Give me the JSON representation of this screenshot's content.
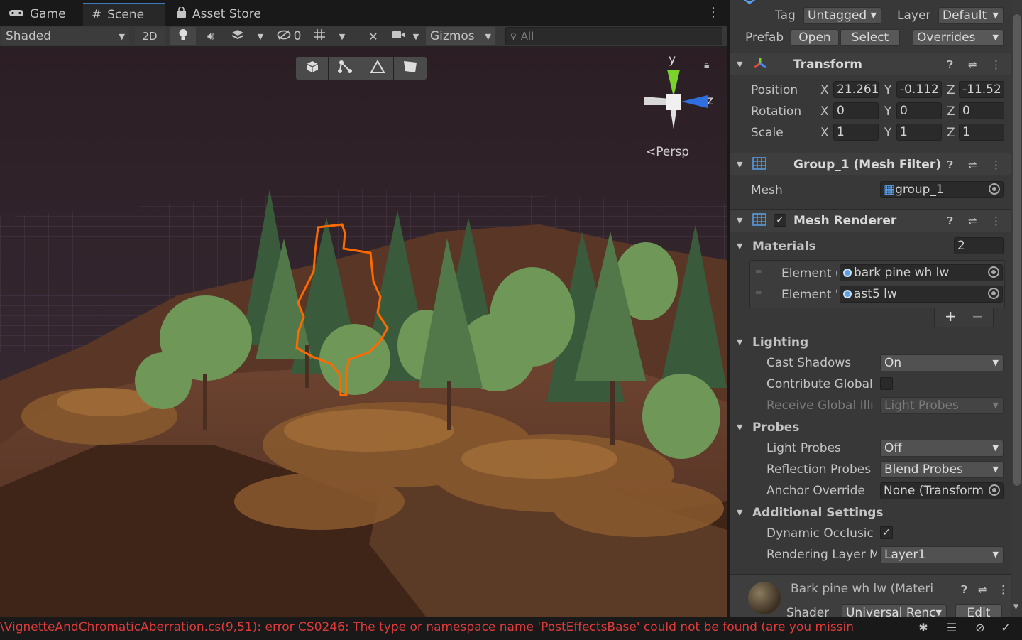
{
  "tabs": [
    {
      "label": "Game",
      "icon": "gamepad-icon"
    },
    {
      "label": "Scene",
      "icon": "grid-icon"
    },
    {
      "label": "Asset Store",
      "icon": "shopping-bag-icon"
    }
  ],
  "toolbar": {
    "shading_mode": "Shaded",
    "mode_2d": "2D",
    "hidden_count": "0",
    "gizmos": "Gizmos",
    "search_placeholder": "All"
  },
  "viewport": {
    "projection_label": "Persp",
    "axis_y": "y",
    "axis_z": "z",
    "selection_color": "#ff6a00"
  },
  "inspector": {
    "tag_label": "Tag",
    "tag_value": "Untagged",
    "layer_label": "Layer",
    "layer_value": "Default",
    "prefab_label": "Prefab",
    "prefab_open": "Open",
    "prefab_select": "Select",
    "prefab_overrides": "Overrides",
    "transform": {
      "title": "Transform",
      "position_label": "Position",
      "rotation_label": "Rotation",
      "scale_label": "Scale",
      "position": {
        "x": "21.261",
        "y": "-0.112",
        "z": "-11.52"
      },
      "rotation": {
        "x": "0",
        "y": "0",
        "z": "0"
      },
      "scale": {
        "x": "1",
        "y": "1",
        "z": "1"
      },
      "x": "X",
      "y": "Y",
      "z": "Z"
    },
    "mesh_filter": {
      "title": "Group_1 (Mesh Filter)",
      "mesh_label": "Mesh",
      "mesh_value": "group_1"
    },
    "mesh_renderer": {
      "title": "Mesh Renderer",
      "materials_label": "Materials",
      "materials_count": "2",
      "elements": [
        {
          "label": "Element (",
          "value": "bark pine wh lw"
        },
        {
          "label": "Element '",
          "value": "ast5 lw"
        }
      ],
      "add": "+",
      "remove": "−",
      "lighting_label": "Lighting",
      "cast_shadows_label": "Cast Shadows",
      "cast_shadows_value": "On",
      "contribute_gi_label": "Contribute Global",
      "receive_gi_label": "Receive Global Illı",
      "receive_gi_value": "Light Probes",
      "probes_label": "Probes",
      "light_probes_label": "Light Probes",
      "light_probes_value": "Off",
      "reflection_probes_label": "Reflection Probes",
      "reflection_probes_value": "Blend Probes",
      "anchor_override_label": "Anchor Override",
      "anchor_override_value": "None (Transform",
      "additional_label": "Additional Settings",
      "dynamic_occlusion_label": "Dynamic Occlusic",
      "rendering_layer_label": "Rendering Layer M",
      "rendering_layer_value": "Layer1"
    },
    "material": {
      "title": "Bark pine wh lw (Materi",
      "shader_label": "Shader",
      "shader_value": "Universal Renc",
      "edit": "Edit"
    }
  },
  "status": {
    "message": "\\VignetteAndChromaticAberration.cs(9,51): error CS0246: The type or namespace name 'PostEffectsBase' could not be found (are you missin",
    "error_color": "#e03b3b"
  }
}
